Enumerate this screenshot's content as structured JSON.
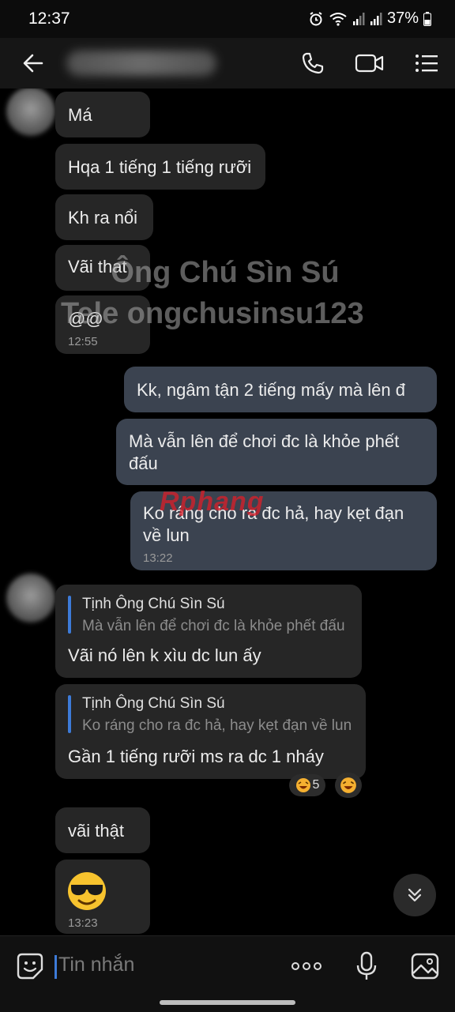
{
  "status_bar": {
    "time": "12:37",
    "battery": "37%"
  },
  "header": {
    "back_icon": "arrow-left-icon",
    "contact_name": "",
    "actions": [
      "phone-icon",
      "video-camera-icon",
      "menu-list-icon"
    ]
  },
  "watermark": {
    "line1": "Ông Chú Sìn Sú",
    "line2": "Tele ongchusinsu123",
    "logo": "Rphang"
  },
  "messages": {
    "m1": {
      "text": "Má"
    },
    "m2": {
      "text": "Hqa 1 tiếng 1 tiếng rưỡi"
    },
    "m3": {
      "text": "Kh ra nổi"
    },
    "m4": {
      "text": "Vãi that"
    },
    "m5": {
      "text": "@@",
      "time": "12:55"
    },
    "m6": {
      "text": "Kk, ngâm tận 2 tiếng mấy mà lên đ"
    },
    "m7": {
      "text": "Mà vẫn lên để chơi đc là khỏe phết\nđấu"
    },
    "m8": {
      "text": "Ko ráng cho ra đc hả, hay kẹt đạn\nvề lun",
      "time": "13:22"
    },
    "m9": {
      "reply_name": "Tịnh Ông Chú Sìn Sú",
      "reply_snippet": "Mà vẫn lên để chơi đc là khỏe phết đấu",
      "text": "Vãi nó lên k xìu dc lun ấy"
    },
    "m10": {
      "reply_name": "Tịnh Ông Chú Sìn Sú",
      "reply_snippet": "Ko ráng cho ra đc hả, hay kẹt đạn về lun",
      "text": "Gần 1 tiếng rưỡi ms ra dc 1 nháy",
      "reaction_count": "5"
    },
    "m11": {
      "text": "vãi thật"
    },
    "m12": {
      "emoji": "cool-sunglasses-emoji",
      "time": "13:23"
    }
  },
  "input": {
    "placeholder": "Tin nhắn",
    "icons": [
      "sticker-icon",
      "more-dots-icon",
      "microphone-icon",
      "image-gallery-icon"
    ]
  },
  "colors": {
    "incoming_bubble": "#262626",
    "outgoing_bubble": "#3b4350",
    "accent": "#3d7bd8"
  }
}
